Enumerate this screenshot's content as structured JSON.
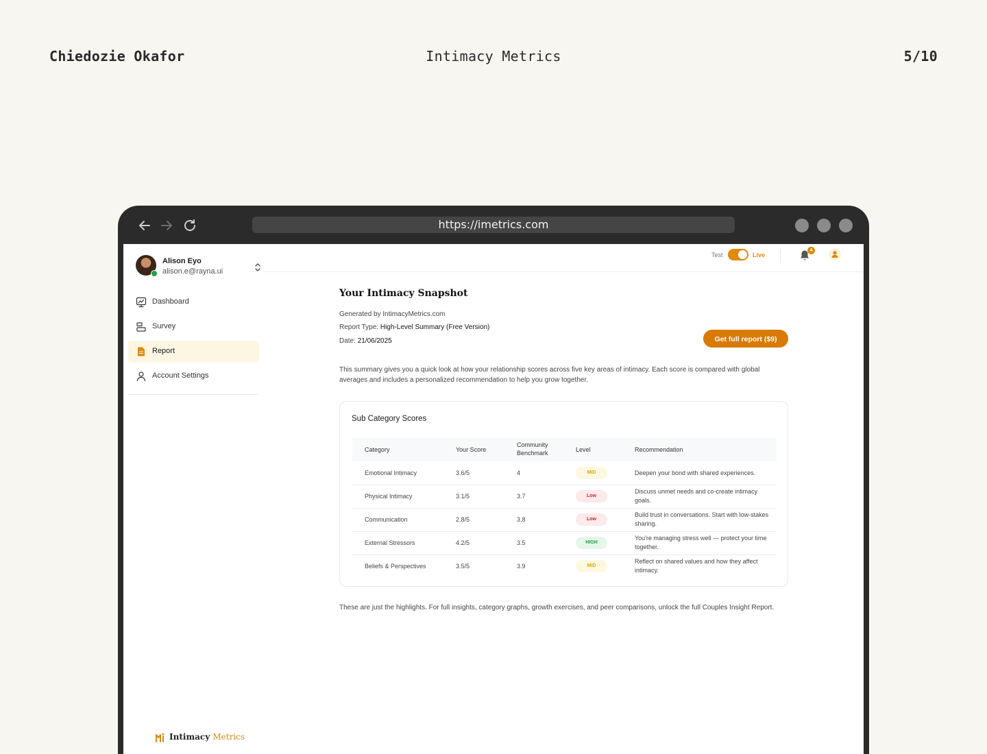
{
  "header": {
    "author": "Chiedozie Okafor",
    "project": "Intimacy Metrics",
    "page": "5/10"
  },
  "browser": {
    "url": "https://imetrics.com"
  },
  "user": {
    "name": "Alison Eyo",
    "email": "alison.e@rayna.ui"
  },
  "sidebar": {
    "items": [
      {
        "label": "Dashboard"
      },
      {
        "label": "Survey"
      },
      {
        "label": "Report"
      },
      {
        "label": "Account Settings"
      }
    ],
    "active": "Report",
    "brand": {
      "part1": "Intimacy",
      "part2": "Metrics"
    }
  },
  "topbar": {
    "test_label": "Test",
    "live_label": "Live",
    "notifications": "4"
  },
  "report": {
    "title": "Your Intimacy Snapshot",
    "generated_by": "Generated by IntimacyMetrics.com",
    "type_label": "Report Type:",
    "type_value": "High-Level Summary (Free Version)",
    "date_label": "Date:",
    "date_value": "21/06/2025",
    "cta": "Get full report ($9)",
    "summary": "This summary gives you a quick look at how your relationship scores across five key areas of intimacy. Each score is compared with global averages and includes a personalized recommendation to help you grow together.",
    "footnote": "These are just the highlights. For full insights, category graphs, growth exercises, and peer comparisons, unlock the full Couples Insight Report."
  },
  "scores": {
    "title": "Sub Category Scores",
    "columns": [
      "Category",
      "Your Score",
      "Community Benchmark",
      "Level",
      "Recommendation"
    ],
    "rows": [
      {
        "category": "Emotional Intimacy",
        "score": "3.6/5",
        "benchmark": "4",
        "level": "MID",
        "level_color": "#e0a800",
        "recommendation": "Deepen your bond with shared experiences."
      },
      {
        "category": "Physical Intimacy",
        "score": "3.1/5",
        "benchmark": "3.7",
        "level": "Low",
        "level_color": "#d1242f",
        "recommendation": "Discuss unmet needs and co-create intimacy goals."
      },
      {
        "category": "Communication",
        "score": "2.8/5",
        "benchmark": "3.8",
        "level": "Low",
        "level_color": "#d1242f",
        "recommendation": "Build trust in conversations. Start with low-stakes sharing."
      },
      {
        "category": "External Stressors",
        "score": "4.2/5",
        "benchmark": "3.5",
        "level": "HIGH",
        "level_color": "#1f9c43",
        "recommendation": "You're managing stress well — protect your time together."
      },
      {
        "category": "Beliefs & Perspectives",
        "score": "3.5/5",
        "benchmark": "3.9",
        "level": "MID",
        "level_color": "#e0a800",
        "recommendation": "Reflect on shared values and how they affect intimacy."
      }
    ]
  },
  "colors": {
    "accent": "#d97a05",
    "active_bg": "#fdf6e3",
    "frame": "#2b2b2b",
    "page_bg": "#f7f6f1"
  }
}
